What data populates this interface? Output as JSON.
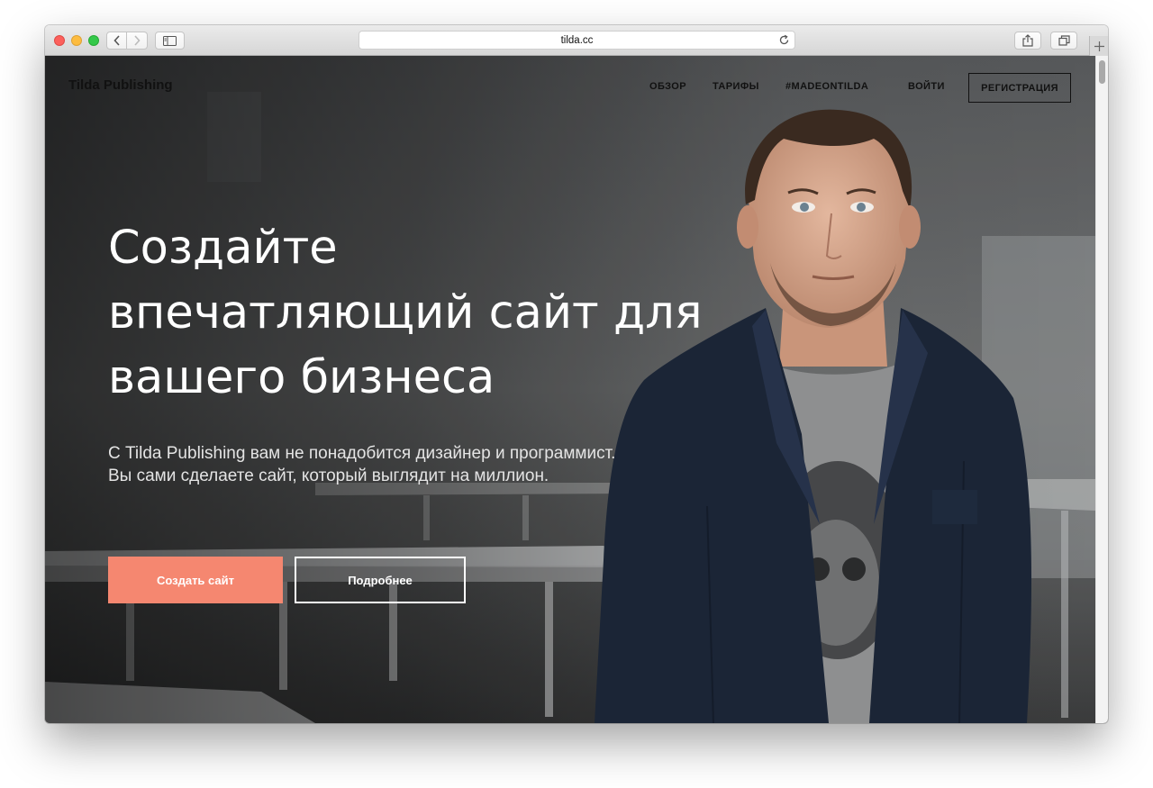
{
  "browser": {
    "url": "tilda.cc",
    "icons": {
      "back": "chevron-left-icon",
      "forward": "chevron-right-icon",
      "sidebar": "sidebar-icon",
      "reload": "reload-icon",
      "share": "share-icon",
      "tabs": "tabs-icon",
      "new_tab": "plus-icon"
    }
  },
  "nav": {
    "logo": "Tilda Publishing",
    "links": [
      "ОБЗОР",
      "ТАРИФЫ",
      "#MADEONTILDA",
      "ВОЙТИ"
    ],
    "register": "РЕГИСТРАЦИЯ"
  },
  "hero": {
    "title_lines": [
      "Создайте",
      "впечатляющий сайт для",
      "вашего бизнеса"
    ],
    "subtitle_lines": [
      "С Tilda Publishing вам не понадобится дизайнер и программист.",
      "Вы сами сделаете сайт, который выглядит на миллион."
    ],
    "primary_button": "Создать сайт",
    "secondary_button": "Подробнее"
  },
  "colors": {
    "accent": "#f58770",
    "hero_text": "#ffffff",
    "jacket": "#1b2536"
  }
}
